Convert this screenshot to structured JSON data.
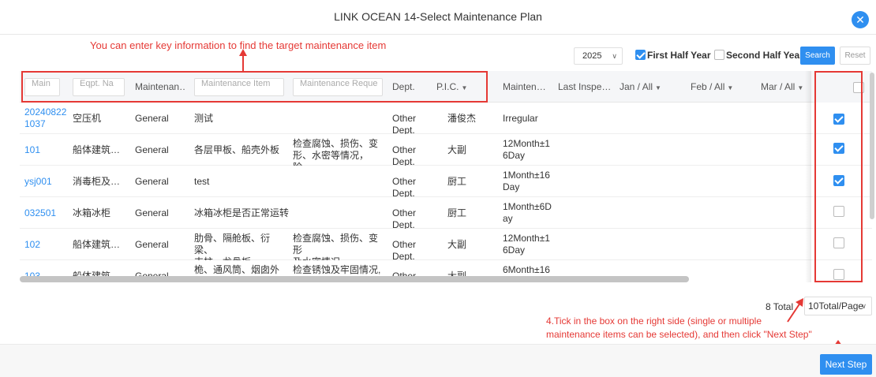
{
  "header": {
    "title": "LINK OCEAN 14-Select Maintenance Plan",
    "close_label": "✕"
  },
  "annotations": {
    "top": "You can enter key information to find the target maintenance item",
    "bottom_line1": "4.Tick in the box on the right side (single or multiple",
    "bottom_line2": "maintenance items can be selected), and then click \"Next Step\""
  },
  "filters": {
    "year": "2025",
    "first_half": {
      "label": "First Half Year",
      "checked": true
    },
    "second_half": {
      "label": "Second Half Year",
      "checked": false
    },
    "search_label": "Search",
    "reset_label": "Reset"
  },
  "table": {
    "search_placeholders": {
      "main_no": "Main",
      "eqpt_name": "Eqpt. Na",
      "item": "Maintenance Item",
      "requirement": "Maintenance Reque"
    },
    "headers": {
      "type": "Maintenan…",
      "dept": "Dept.",
      "pic": "P.I.C.",
      "cycle": "Mainten…",
      "last_inspection": "Last Inspe…",
      "jan": "Jan / All",
      "feb": "Feb / All",
      "mar": "Mar / All"
    },
    "rows": [
      {
        "code1": "20240822",
        "code2": "1037",
        "eqpt": "空压机",
        "type": "General",
        "item1": "测试",
        "item2": "",
        "req1": "",
        "req2": "",
        "dept": "Other Dept.",
        "pic": "潘俊杰",
        "cycle1": "Irregular",
        "cycle2": "",
        "checked": true
      },
      {
        "code1": "101",
        "code2": "",
        "eqpt": "船体建筑…",
        "type": "General",
        "item1": "各层甲板、船壳外板",
        "item2": "",
        "req1": "检查腐蚀、损伤、变",
        "req2": "形、水密等情况，除…",
        "dept": "Other Dept.",
        "pic": "大副",
        "cycle1": "12Month±1",
        "cycle2": "6Day",
        "checked": true
      },
      {
        "code1": "ysj001",
        "code2": "",
        "eqpt": "消毒柜及…",
        "type": "General",
        "item1": "test",
        "item2": "",
        "req1": "",
        "req2": "",
        "dept": "Other Dept.",
        "pic": "厨工",
        "cycle1": "1Month±16",
        "cycle2": "Day",
        "checked": true
      },
      {
        "code1": "032501",
        "code2": "",
        "eqpt": "冰箱冰柜",
        "type": "General",
        "item1": "冰箱冰柜是否正常运转",
        "item2": "",
        "req1": "",
        "req2": "",
        "dept": "Other Dept.",
        "pic": "厨工",
        "cycle1": "1Month±6D",
        "cycle2": "ay",
        "checked": false
      },
      {
        "code1": "102",
        "code2": "",
        "eqpt": "船体建筑…",
        "type": "General",
        "item1": "肋骨、隔舱板、衍梁、",
        "item2": "支柱、龙骨板",
        "req1": "检查腐蚀、损伤、变形",
        "req2": "及水密情况",
        "dept": "Other Dept.",
        "pic": "大副",
        "cycle1": "12Month±1",
        "cycle2": "6Day",
        "checked": false
      },
      {
        "code1": "103",
        "code2": "",
        "eqpt": "船体建筑…",
        "type": "General",
        "item1": "桅、通风筒、烟囱外表",
        "item2": "",
        "req1": "检查锈蚀及牢固情况,",
        "req2": "",
        "dept": "Other Dept.",
        "pic": "大副",
        "cycle1": "6Month±16",
        "cycle2": "",
        "checked": false
      }
    ]
  },
  "pager": {
    "total": "8 Total",
    "page_size": "10Total/Page"
  },
  "footer": {
    "next_label": "Next Step"
  },
  "colors": {
    "accent": "#2f8ff0",
    "annotation": "#e53935"
  }
}
